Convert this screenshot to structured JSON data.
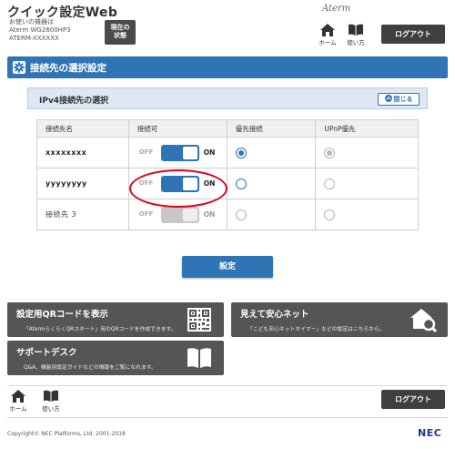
{
  "header": {
    "app_title": "クイック設定Web",
    "device_line1": "お使いの機器は",
    "device_line2": "Aterm WG2600HP3",
    "device_line3": "ATERM-XXXXXX",
    "status_button_line1": "現在の",
    "status_button_line2": "状態",
    "brand": "Aterm",
    "home_label": "ホーム",
    "help_label": "使い方",
    "logout_label": "ログアウト"
  },
  "section": {
    "title": "接続先の選択設定"
  },
  "panel": {
    "title": "IPv4接続先の選択",
    "collapse_label": "閉じる"
  },
  "table": {
    "headers": [
      "接続先名",
      "接続可",
      "優先接続",
      "UPnP優先"
    ],
    "toggle_off_label": "OFF",
    "toggle_on_label": "ON",
    "rows": [
      {
        "name": "xxxxxxxx",
        "connectable": "ON",
        "enabled": true,
        "priority": true,
        "upnp": true
      },
      {
        "name": "yyyyyyyy",
        "connectable": "ON",
        "enabled": true,
        "priority": false,
        "upnp": false
      },
      {
        "name": "接続先 3",
        "connectable": "ON",
        "enabled": false,
        "priority": false,
        "upnp": false
      }
    ]
  },
  "apply_label": "設定",
  "tiles": {
    "qr": {
      "title": "設定用QRコードを表示",
      "desc": "「AtermらくらくQRスタート」用のQRコードを作成できます。"
    },
    "safe_net": {
      "title": "見えて安心ネット",
      "desc": "「こども安心ネットタイマー」などの設定はこちらから。"
    },
    "support": {
      "title": "サポートデスク",
      "desc": "Q&A、機能別設定ガイドなどの情報をご覧になれます。"
    }
  },
  "footer": {
    "home_label": "ホーム",
    "help_label": "使い方",
    "logout_label": "ログアウト",
    "copyright": "Copyright© NEC Platforms, Ltd. 2001-2018",
    "nec_logo": "NEC"
  },
  "colors": {
    "accent": "#2f74b5",
    "dark_button": "#3f3f3f",
    "tile": "#555555",
    "highlight": "#e0001a"
  }
}
